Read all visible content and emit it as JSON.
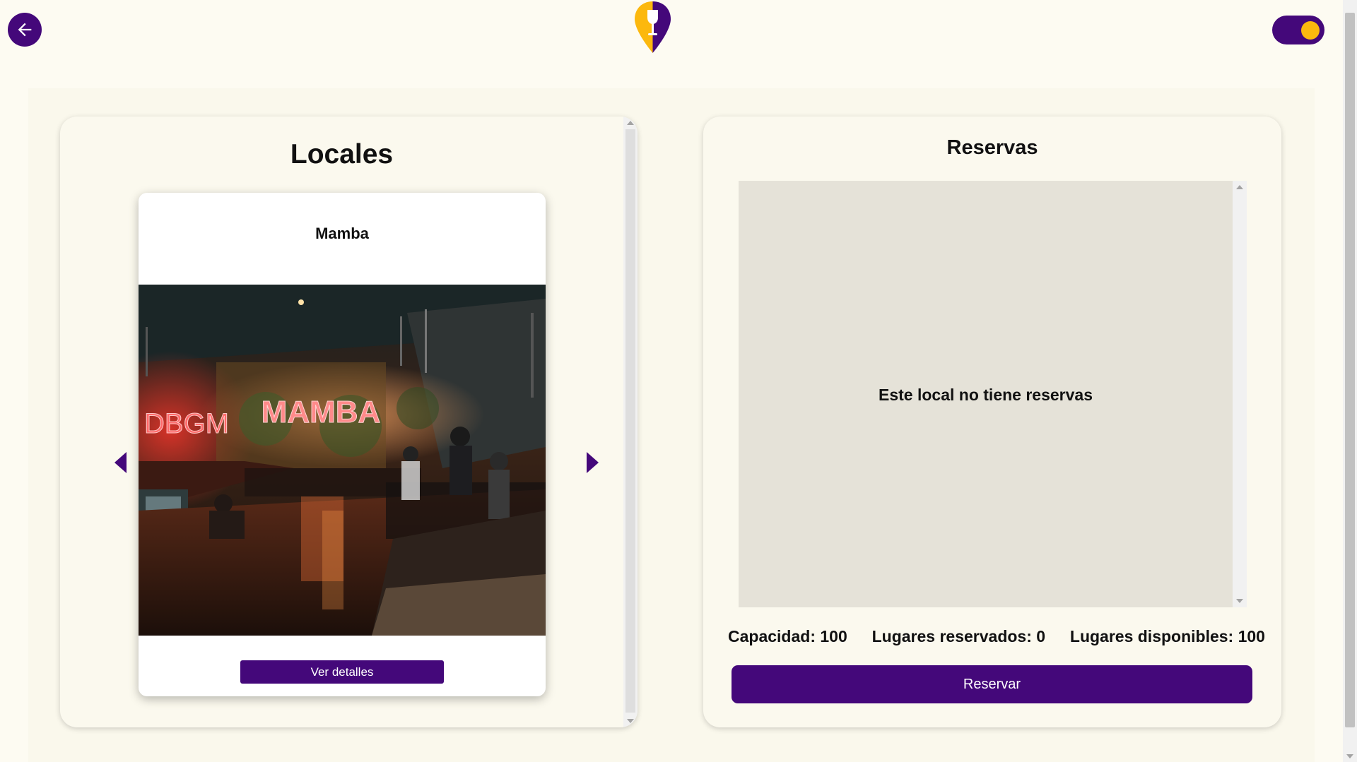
{
  "header": {
    "back_icon": "arrow-left-icon",
    "logo_icon": "wine-glass-map-pin-logo",
    "toggle_icon": "theme-toggle-switch",
    "colors": {
      "primary": "#44087a",
      "accent": "#fcb80e"
    }
  },
  "locales": {
    "title": "Locales",
    "card": {
      "name": "Mamba",
      "image_description": "restaurant-interior-photo",
      "button_label": "Ver detalles"
    },
    "prev_icon": "chevron-left-icon",
    "next_icon": "chevron-right-icon"
  },
  "reservas": {
    "title": "Reservas",
    "empty_message": "Este local no tiene reservas",
    "capacity_text": "Capacidad: 100",
    "reserved_text": "Lugares reservados: 0",
    "available_text": "Lugares disponibles: 100",
    "button_label": "Reservar"
  }
}
